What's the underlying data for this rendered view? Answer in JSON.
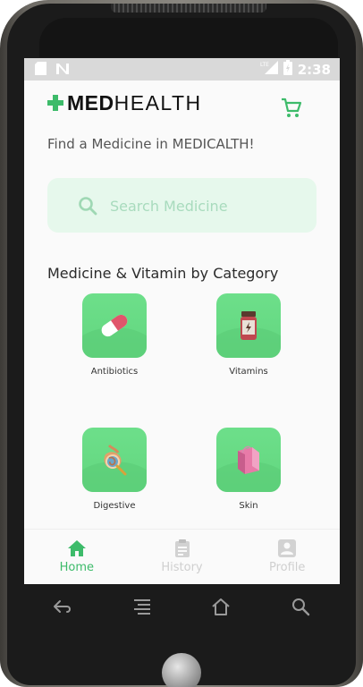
{
  "status_bar": {
    "time": "2:38",
    "network": "LTE"
  },
  "header": {
    "logo_bold": "MED",
    "logo_light": "HEALTH"
  },
  "subtitle": "Find a Medicine in MEDICALTH!",
  "search": {
    "placeholder": "Search Medicine",
    "value": ""
  },
  "section_title": "Medicine & Vitamin by Category",
  "categories": [
    {
      "label": "Antibiotics",
      "icon": "capsule-icon"
    },
    {
      "label": "Vitamins",
      "icon": "vitamin-bottle-icon"
    },
    {
      "label": "Digestive",
      "icon": "digestive-system-icon"
    },
    {
      "label": "Skin",
      "icon": "skin-icon"
    }
  ],
  "bottom_nav": {
    "items": [
      {
        "label": "Home",
        "icon": "home-icon",
        "active": true
      },
      {
        "label": "History",
        "icon": "clipboard-icon",
        "active": false
      },
      {
        "label": "Profile",
        "icon": "profile-icon",
        "active": false
      }
    ]
  },
  "colors": {
    "accent": "#3dbb6a",
    "tile": "#6ddf8a",
    "search_bg": "#e6f8ec",
    "status_bar": "#d9d9d9",
    "inactive": "#cfcfcf"
  }
}
